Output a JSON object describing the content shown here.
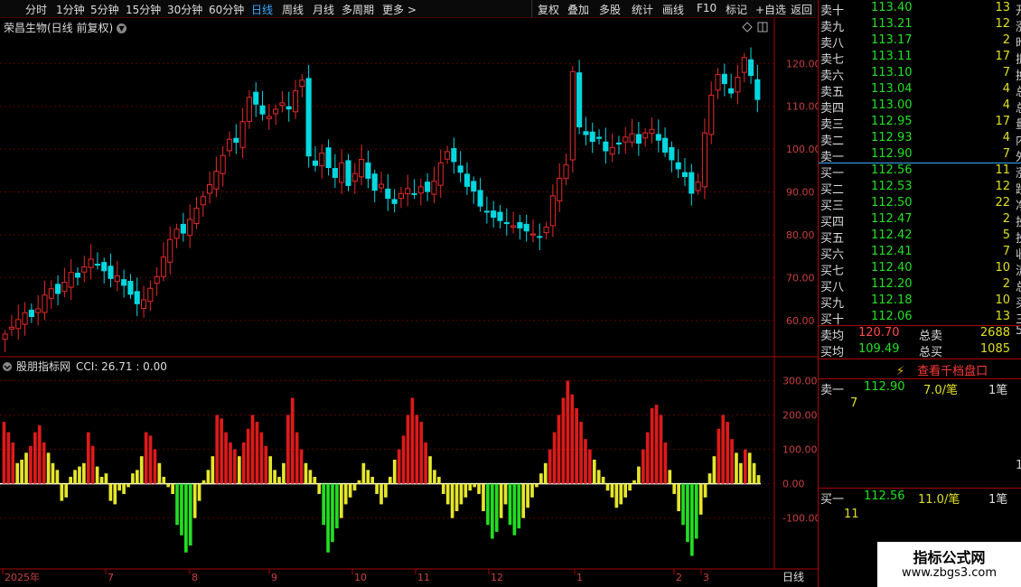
{
  "toolbar": {
    "items": [
      "分时",
      "1分钟",
      "5分钟",
      "15分钟",
      "30分钟",
      "60分钟",
      "日线",
      "周线",
      "月线",
      "多周期",
      "更多 >"
    ],
    "active_index": 6,
    "right_items": [
      "复权",
      "叠加",
      "多股",
      "统计",
      "画线",
      "F10",
      "标记",
      "+自选",
      "返回"
    ]
  },
  "stock": {
    "title": "荣昌生物(日线 前复权)",
    "down_icon": "chevron-down-icon"
  },
  "indicator": {
    "label": "股朋指标网",
    "value_text": "CCI: 26.71 : 0.00"
  },
  "xaxis": {
    "labels": [
      "2025年",
      "7",
      "8",
      "9",
      "10",
      "11",
      "12",
      "1",
      "2",
      "3"
    ],
    "period_label": "日线"
  },
  "orderbook": {
    "asks": [
      {
        "label": "卖十",
        "price": "113.40",
        "vol": "13",
        "edge": "开"
      },
      {
        "label": "卖九",
        "price": "113.21",
        "vol": "12",
        "edge": "涨"
      },
      {
        "label": "卖八",
        "price": "113.17",
        "vol": "2",
        "edge": "昨"
      },
      {
        "label": "卖七",
        "price": "113.11",
        "vol": "17",
        "edge": "振"
      },
      {
        "label": "卖六",
        "price": "113.10",
        "vol": "7",
        "edge": "换"
      },
      {
        "label": "卖五",
        "price": "113.04",
        "vol": "4",
        "edge": "总"
      },
      {
        "label": "卖四",
        "price": "113.00",
        "vol": "4",
        "edge": "总"
      },
      {
        "label": "卖三",
        "price": "112.95",
        "vol": "17",
        "edge": "量"
      },
      {
        "label": "卖二",
        "price": "112.93",
        "vol": "4",
        "edge": "内"
      },
      {
        "label": "卖一",
        "price": "112.90",
        "vol": "7",
        "edge": "外"
      }
    ],
    "bids": [
      {
        "label": "买一",
        "price": "112.56",
        "vol": "11",
        "edge": "涨"
      },
      {
        "label": "买二",
        "price": "112.53",
        "vol": "12",
        "edge": "跌"
      },
      {
        "label": "买三",
        "price": "112.50",
        "vol": "22",
        "edge": "净"
      },
      {
        "label": "买四",
        "price": "112.47",
        "vol": "2",
        "edge": "投"
      },
      {
        "label": "买五",
        "price": "112.42",
        "vol": "5",
        "edge": "投"
      },
      {
        "label": "买六",
        "price": "112.41",
        "vol": "7",
        "edge": "收"
      },
      {
        "label": "买七",
        "price": "112.40",
        "vol": "10",
        "edge": "流"
      },
      {
        "label": "买八",
        "price": "112.20",
        "vol": "2",
        "edge": "总"
      },
      {
        "label": "买九",
        "price": "112.18",
        "vol": "10",
        "edge": "买"
      },
      {
        "label": "买十",
        "price": "112.06",
        "vol": "13",
        "edge": "三"
      }
    ],
    "extra_edge": "5",
    "avg_sell_label": "卖均",
    "avg_sell": "120.70",
    "total_sell_label": "总卖",
    "total_sell": "2688",
    "avg_buy_label": "买均",
    "avg_buy": "109.49",
    "total_buy_label": "总买",
    "total_buy": "1085",
    "depth_button": "查看千档盘口",
    "sell1": {
      "label": "卖一",
      "price": "112.90",
      "per": "7.0/笔",
      "count": "1笔",
      "qty": "7"
    },
    "buy1": {
      "label": "买一",
      "price": "112.56",
      "per": "11.0/笔",
      "count": "1笔",
      "qty": "11"
    },
    "small_edge_1": "1",
    "small_edge_2": "1"
  },
  "colors": {
    "up": "#e52a2a",
    "down": "#00d8e0",
    "cci_pos_high": "#dd1a1a",
    "cci_pos_low": "#e6e62a",
    "cci_neg_high": "#e6e62a",
    "cci_neg_low": "#22dd22",
    "grid": "#5a0000"
  },
  "watermark": {
    "line1": "指标公式网",
    "line2": "www.zbgs3.com"
  },
  "chart_data": [
    {
      "type": "candlestick",
      "title": "荣昌生物(日线 前复权)",
      "yticks": [
        60.0,
        70.0,
        80.0,
        90.0,
        100.0,
        110.0,
        120.0
      ],
      "ylim": [
        53.0,
        128.5
      ],
      "x_month_labels": [
        "2025年",
        "7",
        "8",
        "9",
        "10",
        "11",
        "12",
        "1",
        "2",
        "3"
      ],
      "close_series": [
        56.8,
        58.4,
        60.2,
        61.8,
        60.9,
        62.7,
        65.9,
        67.4,
        66.3,
        68.9,
        71.2,
        70.1,
        72.5,
        74.3,
        73.1,
        71.6,
        69.8,
        70.4,
        68.2,
        66.1,
        63.9,
        64.8,
        67.5,
        70.2,
        74.8,
        78.9,
        81.3,
        80.4,
        83.6,
        86.2,
        88.9,
        91.7,
        94.8,
        98.5,
        102.3,
        101.6,
        106.4,
        112.1,
        110.5,
        108.2,
        107.6,
        109.3,
        110.8,
        109.4,
        113.6,
        116.1,
        98.4,
        96.2,
        99.1,
        95.7,
        93.4,
        96.8,
        91.5,
        94.3,
        97.6,
        93.2,
        90.4,
        91.8,
        88.5,
        87.3,
        89.6,
        90.8,
        89.4,
        91.2,
        90.1,
        92.5,
        96.8,
        99.4,
        97.1,
        94.6,
        91.3,
        90.2,
        86.7,
        85.4,
        84.1,
        83.3,
        82.8,
        82.1,
        81.6,
        80.9,
        80.2,
        79.4,
        81.8,
        89.1,
        93.2,
        96.3,
        118.1,
        105.2,
        103.4,
        101.8,
        102.5,
        99.6,
        100.4,
        101.2,
        102.8,
        103.6,
        101.4,
        103.8,
        104.6,
        102.1,
        99.3,
        97.5,
        95.4,
        93.6,
        89.7,
        92.3,
        103.8,
        112.6,
        117.4,
        115.3,
        113.1,
        116.8,
        121.4,
        117.2,
        111.6
      ],
      "yaxis_unit": ""
    },
    {
      "type": "bar",
      "title": "股朋指标网",
      "value_label": "CCI: 26.71 : 0.00",
      "yticks": [
        -100.0,
        0.0,
        100.0,
        200.0,
        300.0
      ],
      "ylim": [
        -235,
        325
      ],
      "values": [
        180,
        150,
        120,
        60,
        70,
        90,
        110,
        150,
        170,
        120,
        90,
        60,
        40,
        -50,
        -40,
        20,
        40,
        50,
        60,
        150,
        110,
        50,
        20,
        30,
        -50,
        -60,
        -20,
        -30,
        -10,
        30,
        40,
        80,
        150,
        140,
        100,
        60,
        20,
        -10,
        -30,
        -120,
        -150,
        -200,
        -180,
        -100,
        -50,
        10,
        40,
        80,
        200,
        190,
        150,
        120,
        100,
        80,
        120,
        160,
        200,
        180,
        150,
        110,
        80,
        40,
        20,
        60,
        200,
        250,
        150,
        100,
        60,
        40,
        20,
        -30,
        -120,
        -200,
        -170,
        -130,
        -100,
        -60,
        -40,
        -20,
        10,
        60,
        40,
        20,
        -30,
        -60,
        -40,
        20,
        70,
        100,
        140,
        200,
        250,
        200,
        180,
        120,
        80,
        40,
        20,
        -30,
        -60,
        -100,
        -80,
        -60,
        -40,
        -20,
        -10,
        -30,
        -80,
        -120,
        -160,
        -140,
        -100,
        -60,
        -120,
        -150,
        -130,
        -100,
        -70,
        -40,
        -10,
        30,
        60,
        100,
        150,
        200,
        250,
        300,
        260,
        220,
        180,
        130,
        100,
        70,
        40,
        20,
        -20,
        -40,
        -70,
        -60,
        -40,
        -20,
        10,
        50,
        100,
        150,
        220,
        230,
        200,
        120,
        40,
        -30,
        -80,
        -120,
        -170,
        -210,
        -160,
        -90,
        -40,
        30,
        80,
        160,
        200,
        180,
        130,
        90,
        60,
        100,
        90,
        60,
        25
      ]
    }
  ]
}
